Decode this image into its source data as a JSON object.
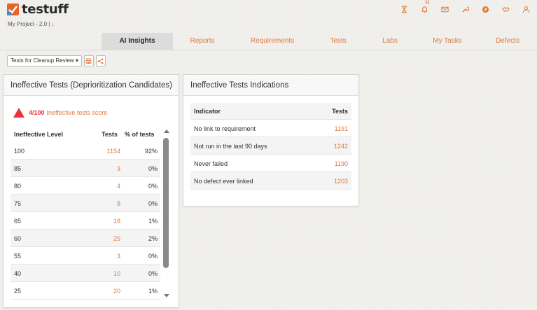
{
  "app": {
    "name": "testuff",
    "project": "My Project - 2.0 |",
    "project_arrow": "↓"
  },
  "header": {
    "icons": [
      {
        "name": "hourglass-icon",
        "glyph": "⧗"
      },
      {
        "name": "bell-icon",
        "badge": "11"
      },
      {
        "name": "mail-icon"
      },
      {
        "name": "wrench-icon"
      },
      {
        "name": "help-icon"
      },
      {
        "name": "handshake-icon"
      },
      {
        "name": "user-icon"
      }
    ],
    "bell_badge": "11"
  },
  "tabs": [
    "AI Insights",
    "Reports",
    "Requirements",
    "Tests",
    "Labs",
    "My Tasks",
    "Defects"
  ],
  "toolbar": {
    "view_select": "Tests for Cleanup Review ▾"
  },
  "left_panel": {
    "title": "Ineffective Tests (Deprioritization Candidates)",
    "score_value": "4/100",
    "score_label": "Ineffective tests score",
    "columns": [
      "Ineffective Level",
      "Tests",
      "% of tests"
    ],
    "rows": [
      [
        "100",
        "1154",
        "92%"
      ],
      [
        "85",
        "3",
        "0%"
      ],
      [
        "80",
        "4",
        "0%"
      ],
      [
        "75",
        "8",
        "0%"
      ],
      [
        "65",
        "18",
        "1%"
      ],
      [
        "60",
        "25",
        "2%"
      ],
      [
        "55",
        "3",
        "0%"
      ],
      [
        "40",
        "10",
        "0%"
      ],
      [
        "25",
        "20",
        "1%"
      ]
    ]
  },
  "right_panel": {
    "title": "Ineffective Tests Indications",
    "columns": [
      "Indicator",
      "Tests"
    ],
    "rows": [
      [
        "No link to requirement",
        "1191"
      ],
      [
        "Not run in the last 90 days",
        "1242"
      ],
      [
        "Never failed",
        "1190"
      ],
      [
        "No defect ever linked",
        "1203"
      ]
    ]
  },
  "colors": {
    "accent": "#e07a3e",
    "alert": "#e8333a",
    "active_tab_bg": "#dcdcdc"
  }
}
